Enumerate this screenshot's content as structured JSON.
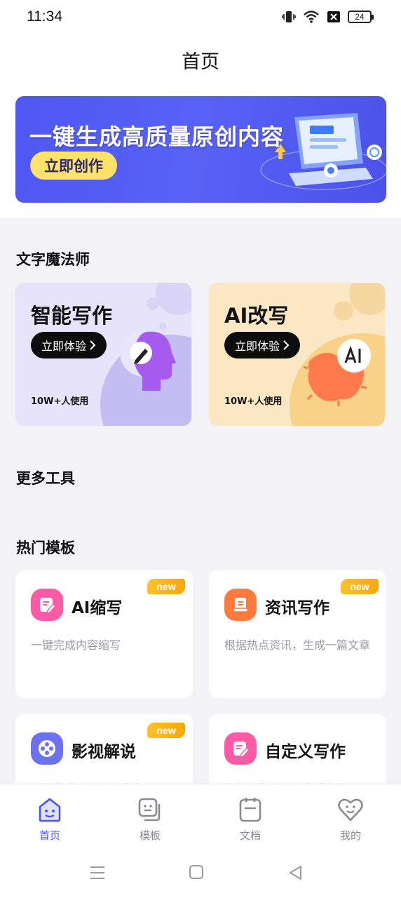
{
  "status_bar": {
    "time": "11:34",
    "battery": "24",
    "icons": [
      "vibrate-icon",
      "wifi-icon",
      "sim-off-icon",
      "battery-icon"
    ]
  },
  "header": {
    "title": "首页"
  },
  "banner": {
    "headline": "一键生成高质量原创内容",
    "button_label": "立即创作",
    "colors": {
      "background": "#4e58f2",
      "button": "#ffe26a"
    }
  },
  "magician_section": {
    "title": "文字魔法师",
    "cards": [
      {
        "title": "智能写作",
        "button_label": "立即体验",
        "users": "10W+人使用",
        "icon": "ai-head-pen-icon",
        "background": "#e6e3fb"
      },
      {
        "title": "AI改写",
        "button_label": "立即体验",
        "users": "10W+人使用",
        "icon": "ai-badge-icon",
        "background": "#fbe7c4"
      }
    ]
  },
  "more_tools": {
    "title": "更多工具"
  },
  "templates_section": {
    "title": "热门模板",
    "cards": [
      {
        "title": "AI缩写",
        "description": "一键完成内容缩写",
        "badge": "new",
        "icon": "doc-pen-icon",
        "icon_color": "#ff5aa6"
      },
      {
        "title": "资讯写作",
        "description": "根据热点资讯，生成一篇文章",
        "badge": "new",
        "icon": "news-doc-icon",
        "icon_color": "#ff7a3d"
      },
      {
        "title": "影视解说",
        "description": "一键生成影视解说文案",
        "badge": "new",
        "icon": "film-reel-icon",
        "icon_color": "#6b72f2"
      },
      {
        "title": "自定义写作",
        "description": "根据自定义输入生成文章",
        "badge": "",
        "icon": "doc-pen-icon",
        "icon_color": "#ff5aa6"
      }
    ]
  },
  "tab_bar": {
    "active": "首页",
    "accent": "#4a55e8",
    "items": [
      {
        "label": "首页",
        "icon": "home-icon"
      },
      {
        "label": "模板",
        "icon": "template-icon"
      },
      {
        "label": "文档",
        "icon": "document-icon"
      },
      {
        "label": "我的",
        "icon": "profile-heart-icon"
      }
    ]
  },
  "system_nav": {
    "buttons": [
      "menu-icon",
      "home-square-icon",
      "back-triangle-icon"
    ]
  }
}
